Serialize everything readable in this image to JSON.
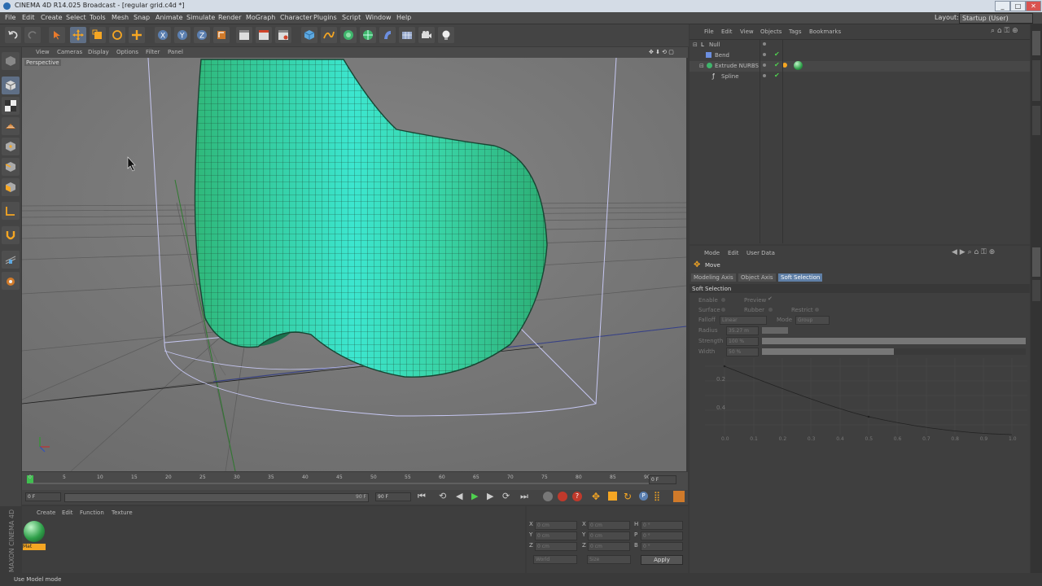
{
  "window": {
    "title": "CINEMA 4D R14.025 Broadcast - [regular grid.c4d *]"
  },
  "menu": {
    "items": [
      "File",
      "Edit",
      "Create",
      "Select",
      "Tools",
      "Mesh",
      "Snap",
      "Animate",
      "Simulate",
      "Render",
      "MoGraph",
      "Character",
      "Plugins",
      "Script",
      "Window",
      "Help"
    ],
    "layout_label": "Layout:",
    "layout_value": "Startup (User)"
  },
  "viewport": {
    "menu": [
      "View",
      "Cameras",
      "Display",
      "Options",
      "Filter",
      "Panel"
    ],
    "label": "Perspective"
  },
  "timeline": {
    "ticks": [
      "0",
      "5",
      "10",
      "15",
      "20",
      "25",
      "30",
      "35",
      "40",
      "45",
      "50",
      "55",
      "60",
      "65",
      "70",
      "75",
      "80",
      "85",
      "90"
    ],
    "current": "0 F",
    "start": "0 F",
    "end": "90 F",
    "end2": "90 F"
  },
  "material_manager": {
    "menu": [
      "Create",
      "Edit",
      "Function",
      "Texture"
    ],
    "material_name": "Mat"
  },
  "coordinates": {
    "rows": [
      {
        "a": "X",
        "av": "0 cm",
        "b": "X",
        "bv": "0 cm",
        "c": "H",
        "cv": "0 °"
      },
      {
        "a": "Y",
        "av": "0 cm",
        "b": "Y",
        "bv": "0 cm",
        "c": "P",
        "cv": "0 °"
      },
      {
        "a": "Z",
        "av": "0 cm",
        "b": "Z",
        "bv": "0 cm",
        "c": "B",
        "cv": "0 °"
      }
    ],
    "mode1": "World",
    "mode2": "Size",
    "apply": "Apply"
  },
  "status": {
    "text": "Use Model mode"
  },
  "objects": {
    "menu": [
      "File",
      "Edit",
      "View",
      "Objects",
      "Tags",
      "Bookmarks"
    ],
    "items": [
      "Null",
      "Bend",
      "Extrude NURBS",
      "Spline"
    ]
  },
  "attributes": {
    "menu": [
      "Mode",
      "Edit",
      "User Data"
    ],
    "tool": "Move",
    "tabs": [
      "Modeling Axis",
      "Object Axis",
      "Soft Selection"
    ],
    "section": "Soft Selection",
    "enable": "Enable",
    "preview": "Preview",
    "surface": "Surface",
    "rubber": "Rubber",
    "restrict": "Restrict",
    "falloff": "Falloff",
    "falloff_value": "Linear",
    "mode": "Mode",
    "mode_value": "Group",
    "radius": "Radius",
    "radius_value": "35.27 m",
    "strength": "Strength",
    "strength_value": "100 %",
    "width": "Width",
    "width_value": "50 %",
    "strength_level": 1.0,
    "width_level": 0.5,
    "graph_y": [
      "0.2",
      "0.4"
    ],
    "graph_x": [
      "0.0",
      "0.1",
      "0.2",
      "0.3",
      "0.4",
      "0.5",
      "0.6",
      "0.7",
      "0.8",
      "0.9",
      "1.0"
    ]
  },
  "brand": {
    "name": "MAXON CINEMA 4D"
  },
  "colors": {
    "mesh": "#3fd08f",
    "highlight": "#39ead7",
    "selected_tab": "#5f7fa6",
    "accent_orange": "#f5a623"
  }
}
